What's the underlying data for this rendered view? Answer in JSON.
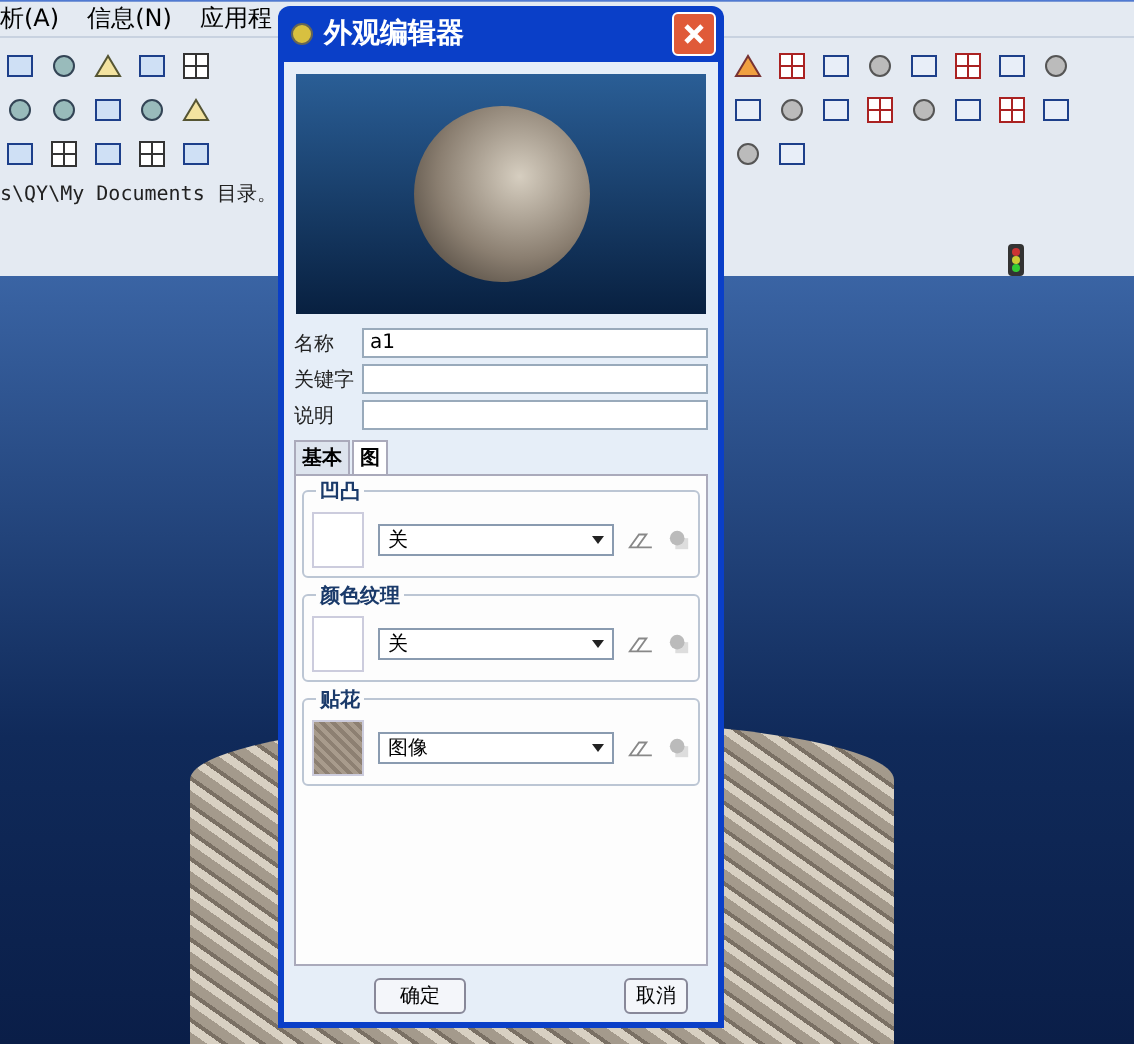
{
  "app": {
    "menu": [
      "析(A)",
      "信息(N)",
      "应用程"
    ],
    "status_message": "s\\QY\\My Documents 目录。"
  },
  "dialog": {
    "title": "外观编辑器",
    "fields": [
      {
        "label": "名称",
        "value": "a1"
      },
      {
        "label": "关键字"
      },
      {
        "label": "说明"
      }
    ],
    "tabs": [
      {
        "label": "基本",
        "selected": false
      },
      {
        "label": "图",
        "selected": true
      }
    ],
    "groups": [
      {
        "title": "凹凸",
        "value": "关",
        "kind": "blank"
      },
      {
        "title": "颜色纹理",
        "value": "关",
        "kind": "blank"
      },
      {
        "title": "贴花",
        "value": "图像",
        "kind": "texture"
      }
    ],
    "buttons": [
      "确定",
      "取消"
    ]
  }
}
